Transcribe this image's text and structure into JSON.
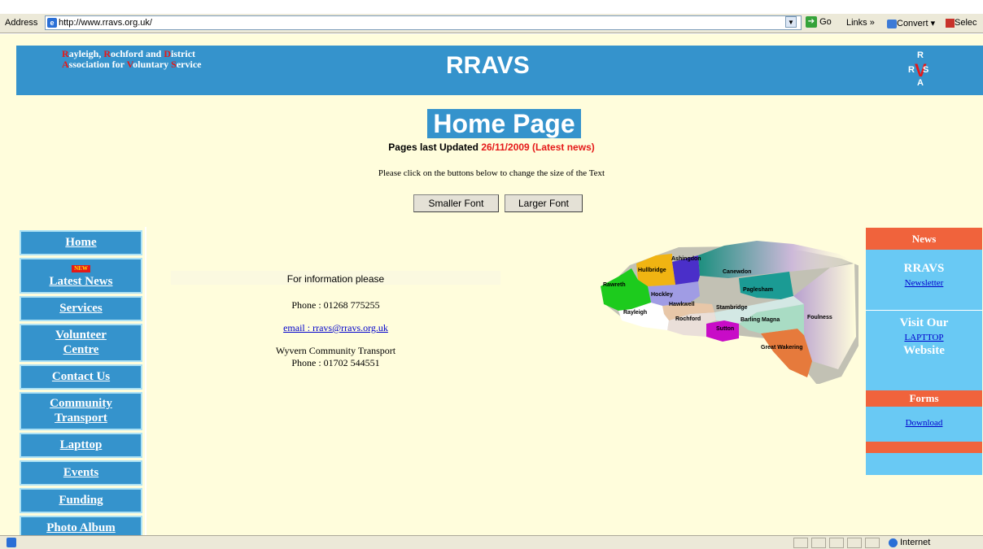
{
  "browser": {
    "address_label": "Address",
    "address_access_key": "d",
    "url": "http://www.rravs.org.uk/",
    "go_label": "Go",
    "links_label": "Links »",
    "convert_label": "Convert ▾",
    "select_label": "Selec"
  },
  "banner": {
    "org_line1_parts": [
      [
        "R",
        "ayleigh, "
      ],
      [
        "R",
        "ochford and "
      ],
      [
        "D",
        "istrict"
      ]
    ],
    "org_line2_parts": [
      [
        "A",
        "ssociation for "
      ],
      [
        "V",
        "oluntary "
      ],
      [
        "S",
        "ervice"
      ]
    ],
    "site_title": "RRAVS",
    "logo_letters": [
      "R",
      "R",
      "S",
      "A"
    ],
    "logo_v": "V"
  },
  "main": {
    "heading": "Home Page",
    "updated_prefix": "Pages last Updated ",
    "updated_date": "26/11/2009",
    "latest_news_link": " (Latest news)",
    "font_instruction": "Please click on the buttons below to change the size of the Text",
    "smaller_font": "Smaller Font",
    "larger_font": "Larger Font"
  },
  "nav": {
    "new_badge": "NEW",
    "items": [
      {
        "label": "Home",
        "lines": [
          "Home"
        ]
      },
      {
        "label": "Latest News",
        "lines": [
          "Latest News"
        ],
        "badge": true
      },
      {
        "label": "Services",
        "lines": [
          "Services"
        ]
      },
      {
        "label": "Volunteer Centre",
        "lines": [
          "Volunteer",
          "Centre"
        ]
      },
      {
        "label": "Contact Us",
        "lines": [
          "Contact Us"
        ]
      },
      {
        "label": "Community Transport",
        "lines": [
          "Community",
          "Transport"
        ]
      },
      {
        "label": "Lapttop",
        "lines": [
          "Lapttop"
        ]
      },
      {
        "label": "Events",
        "lines": [
          "Events"
        ]
      },
      {
        "label": "Funding",
        "lines": [
          "Funding"
        ]
      },
      {
        "label": "Photo Album",
        "lines": [
          "Photo Album"
        ]
      }
    ]
  },
  "info": {
    "heading": "For information please",
    "phone": "Phone : 01268 775255",
    "email": "email : rravs@rravs.org.uk",
    "transport_name": "Wyvern Community Transport",
    "transport_phone": "Phone : 01702 544551"
  },
  "map": {
    "areas": [
      "Ashingdon",
      "Hullbridge",
      "Rawreth",
      "Canewdon",
      "Hockley",
      "Paglesham",
      "Hawkwell",
      "Stambridge",
      "Rayleigh",
      "Rochford",
      "Barling Magna",
      "Foulness",
      "Sutton",
      "Great Wakering"
    ]
  },
  "right_panel": {
    "news_header": "News",
    "newsletter_title": "RRAVS",
    "newsletter_link": "Newsletter",
    "visit_title": "Visit Our",
    "lapttop_link": "LAPTTOP",
    "website_label": "Website",
    "forms_header": "Forms",
    "download_link": "Download"
  },
  "status": {
    "zone": "Internet"
  }
}
